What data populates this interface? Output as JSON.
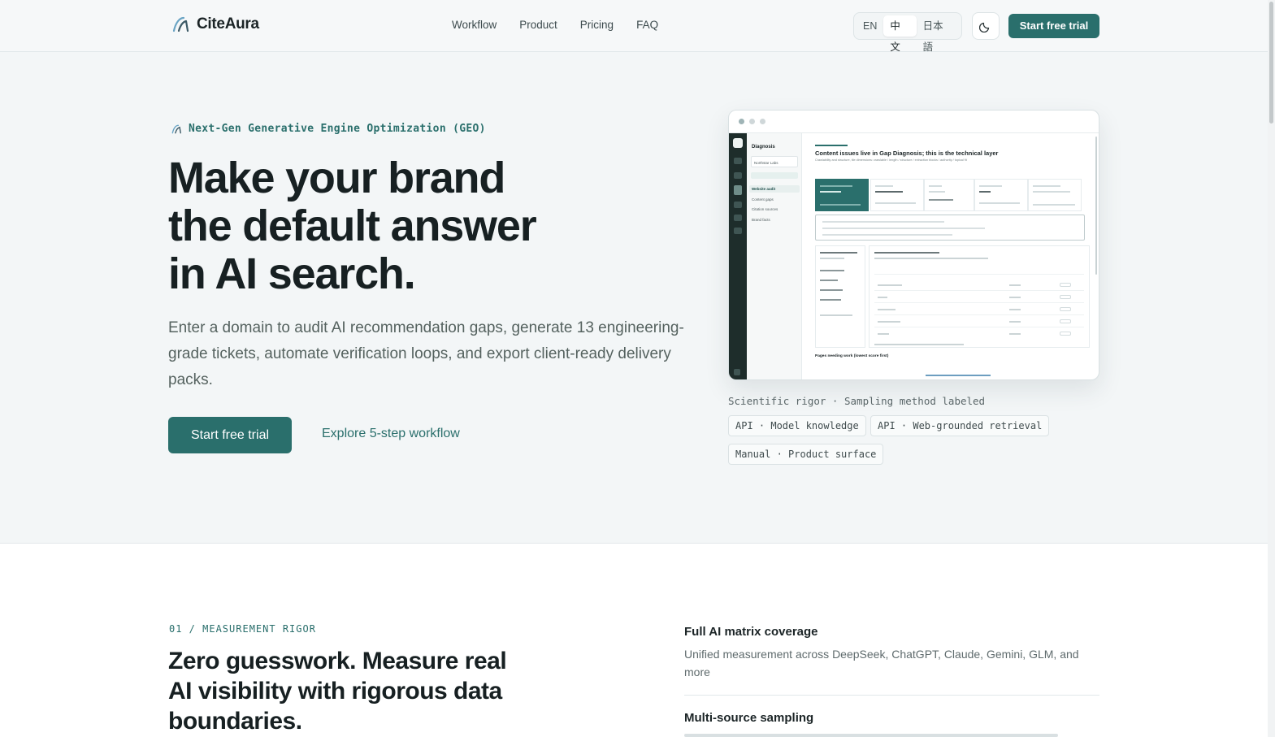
{
  "brand": {
    "name": "CiteAura"
  },
  "nav": {
    "items": [
      "Workflow",
      "Product",
      "Pricing",
      "FAQ"
    ]
  },
  "languages": {
    "en": "EN",
    "zh": "中文",
    "ja": "日本語",
    "selected": "中文"
  },
  "header": {
    "cta": "Start free trial",
    "theme_icon": "moon-icon"
  },
  "hero": {
    "eyebrow": "Next-Gen Generative Engine Optimization (GEO)",
    "title_line1": "Make your brand",
    "title_line2": "the default answer",
    "title_line3": "in AI search.",
    "subtitle": "Enter a domain to audit AI recommendation gaps, generate 13 engineering-grade tickets, automate verification loops, and export client-ready delivery packs.",
    "primary_cta": "Start free trial",
    "secondary_cta": "Explore 5-step workflow"
  },
  "preview": {
    "sidebar_title": "Diagnosis",
    "sidebar_workspace": "Northstar Labs",
    "sidebar_items": [
      "Website audit",
      "Content gaps",
      "Citation sources",
      "Brand facts"
    ],
    "main_heading": "Content issues live in Gap Diagnosis; this is the technical layer",
    "main_sub": "Crawlability and structure, tile dimensions: crawlable / length / structure / extraction blocks / authority / topical fit",
    "footer_heading": "Pages needing work (lowest score first)"
  },
  "rigor": {
    "label": "Scientific rigor · Sampling method labeled",
    "chips": [
      "API · Model knowledge",
      "API · Web-grounded retrieval",
      "Manual · Product surface"
    ]
  },
  "measurement": {
    "eyebrow": "01 / MEASUREMENT RIGOR",
    "title": "Zero guesswork. Measure real AI visibility with rigorous data boundaries.",
    "features": [
      {
        "title": "Full AI matrix coverage",
        "desc": "Unified measurement across DeepSeek, ChatGPT, Claude, Gemini, GLM, and more"
      },
      {
        "title": "Multi-source sampling",
        "desc": ""
      }
    ]
  },
  "colors": {
    "accent": "#2a6f6c",
    "text": "#172022",
    "background": "#f3f6f7"
  }
}
